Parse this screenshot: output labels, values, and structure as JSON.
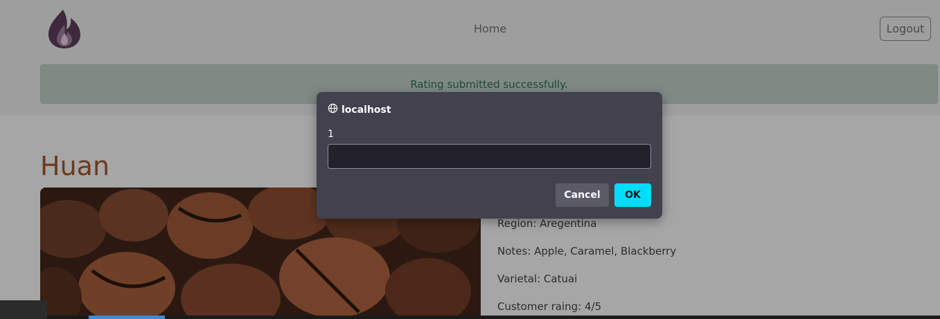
{
  "nav": {
    "home_label": "Home",
    "logout_label": "Logout",
    "logo_icon": "flame-logo-icon"
  },
  "alert": {
    "message": "Rating submitted successfully."
  },
  "product": {
    "title": "Huan",
    "region": "Region: Aregentina",
    "notes": "Notes: Apple, Caramel, Blackberry",
    "varietal": "Varietal: Catuai",
    "rating": "Customer raing: 4/5"
  },
  "dialog": {
    "origin": "localhost",
    "origin_icon": "globe-icon",
    "message": "1",
    "input_value": "",
    "cancel_label": "Cancel",
    "ok_label": "OK"
  },
  "colors": {
    "accent_ok": "#00ddff",
    "title_brown": "#6a3a20"
  }
}
